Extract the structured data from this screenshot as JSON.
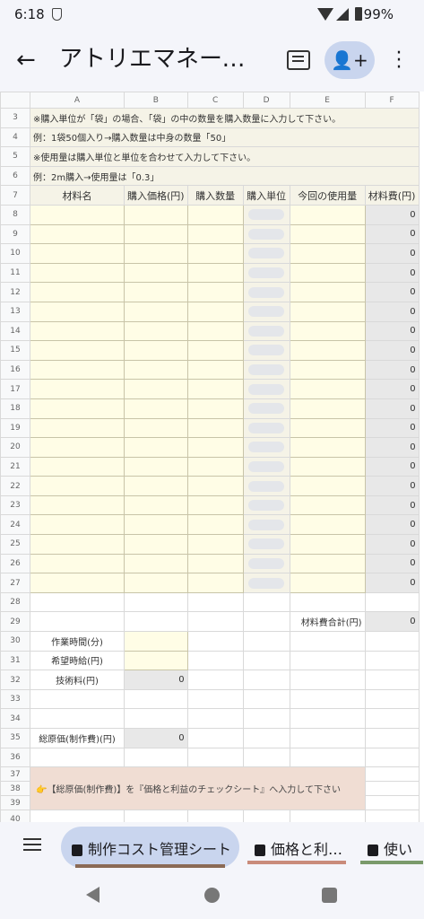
{
  "status": {
    "time": "6:18",
    "battery": "99%"
  },
  "appbar": {
    "title": "アトリエマネージ…"
  },
  "columns": [
    "A",
    "B",
    "C",
    "D",
    "E",
    "F"
  ],
  "notes": [
    {
      "row": "3",
      "text": "※購入単位が「袋」の場合、「袋」の中の数量を購入数量に入力して下さい。"
    },
    {
      "row": "4",
      "text": "例：1袋50個入り→購入数量は中身の数量「50」"
    },
    {
      "row": "5",
      "text": "※使用量は購入単位と単位を合わせて入力して下さい。"
    },
    {
      "row": "6",
      "text": "例：2m購入→使用量は「0.3」"
    }
  ],
  "headers": {
    "row": "7",
    "material": "材料名",
    "price": "購入価格(円)",
    "qty": "購入数量",
    "unit": "購入単位",
    "usage": "今回の使用量",
    "cost": "材料費(円)"
  },
  "item_rows": [
    "8",
    "9",
    "10",
    "11",
    "12",
    "13",
    "14",
    "15",
    "16",
    "17",
    "18",
    "19",
    "20",
    "21",
    "22",
    "23",
    "24",
    "25",
    "26",
    "27"
  ],
  "item_cost": "0",
  "summary": {
    "r28": "28",
    "r29": "29",
    "material_total_label": "材料費合計(円)",
    "material_total": "0",
    "r30": "30",
    "work_time_label": "作業時間(分)",
    "r31": "31",
    "wage_label": "希望時給(円)",
    "r32": "32",
    "tech_fee_label": "技術料(円)",
    "tech_fee": "0",
    "r33": "33",
    "r34": "34",
    "r35": "35",
    "total_cost_label": "総原価(制作費)(円)",
    "total_cost": "0",
    "r36": "36",
    "r37": "37",
    "r38": "38",
    "instruction": "👉【総原価(制作費)】を『価格と利益のチェックシート』へ入力して下さい",
    "r39": "39",
    "r40": "40"
  },
  "tabs": [
    {
      "label": "制作コスト管理シート",
      "color": "#8b6a55"
    },
    {
      "label": "価格と利…",
      "color": "#c98b7a"
    },
    {
      "label": "使い",
      "color": "#7a9a6a"
    }
  ]
}
